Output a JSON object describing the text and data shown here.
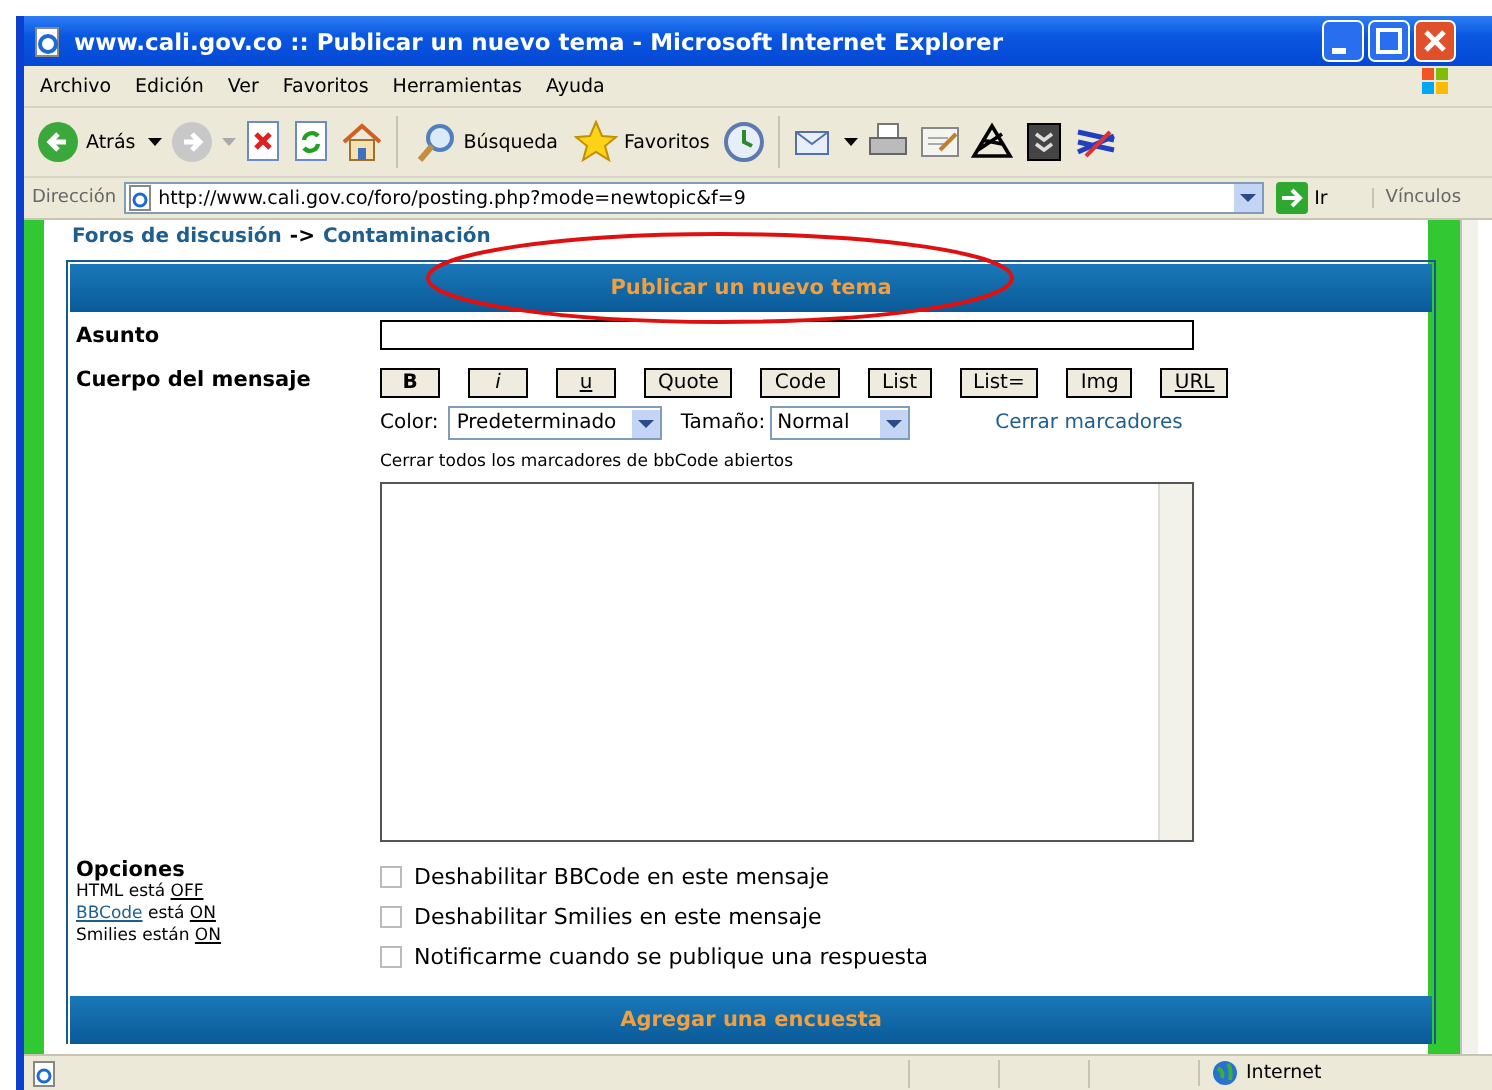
{
  "window": {
    "title": "www.cali.gov.co :: Publicar un nuevo tema - Microsoft Internet Explorer"
  },
  "menu": [
    "Archivo",
    "Edición",
    "Ver",
    "Favoritos",
    "Herramientas",
    "Ayuda"
  ],
  "toolbar": {
    "back": "Atrás",
    "search": "Búsqueda",
    "favorites": "Favoritos"
  },
  "address_bar": {
    "label": "Dirección",
    "url": "http://www.cali.gov.co/foro/posting.php?mode=newtopic&f=9",
    "go": "Ir",
    "links": "Vínculos"
  },
  "breadcrumb": {
    "forum": "Foros de discusión",
    "separator": "->",
    "topic": "Contaminación"
  },
  "form": {
    "header": "Publicar un nuevo tema",
    "subject_label": "Asunto",
    "body_label": "Cuerpo del mensaje",
    "format_buttons": [
      {
        "label": "B",
        "kind": "bold"
      },
      {
        "label": "i",
        "kind": "italic"
      },
      {
        "label": "u",
        "kind": "underline"
      },
      {
        "label": "Quote",
        "kind": "plain"
      },
      {
        "label": "Code",
        "kind": "plain"
      },
      {
        "label": "List",
        "kind": "plain"
      },
      {
        "label": "List=",
        "kind": "plain"
      },
      {
        "label": "Img",
        "kind": "plain"
      },
      {
        "label": "URL",
        "kind": "underline"
      }
    ],
    "color_label": "Color:",
    "color_value": "Predeterminado",
    "size_label": "Tamaño:",
    "size_value": "Normal",
    "close_tags": "Cerrar marcadores",
    "close_hint": "Cerrar todos los marcadores de bbCode abiertos",
    "options_label": "Opciones",
    "option_status": [
      {
        "name": "HTML",
        "verb": "está",
        "value": "OFF",
        "link": false
      },
      {
        "name": "BBCode",
        "verb": "está",
        "value": "ON",
        "link": true
      },
      {
        "name": "Smilies",
        "verb": "están",
        "value": "ON",
        "link": false
      }
    ],
    "options": [
      {
        "label": "Deshabilitar BBCode en este mensaje",
        "checked": false
      },
      {
        "label": "Deshabilitar Smilies en este mensaje",
        "checked": false
      },
      {
        "label": "Notificarme cuando se publique una respuesta",
        "checked": false
      }
    ],
    "poll_header": "Agregar una encuesta"
  },
  "annotation": {
    "kind": "ellipse"
  },
  "status_bar": {
    "zone": "Internet"
  }
}
